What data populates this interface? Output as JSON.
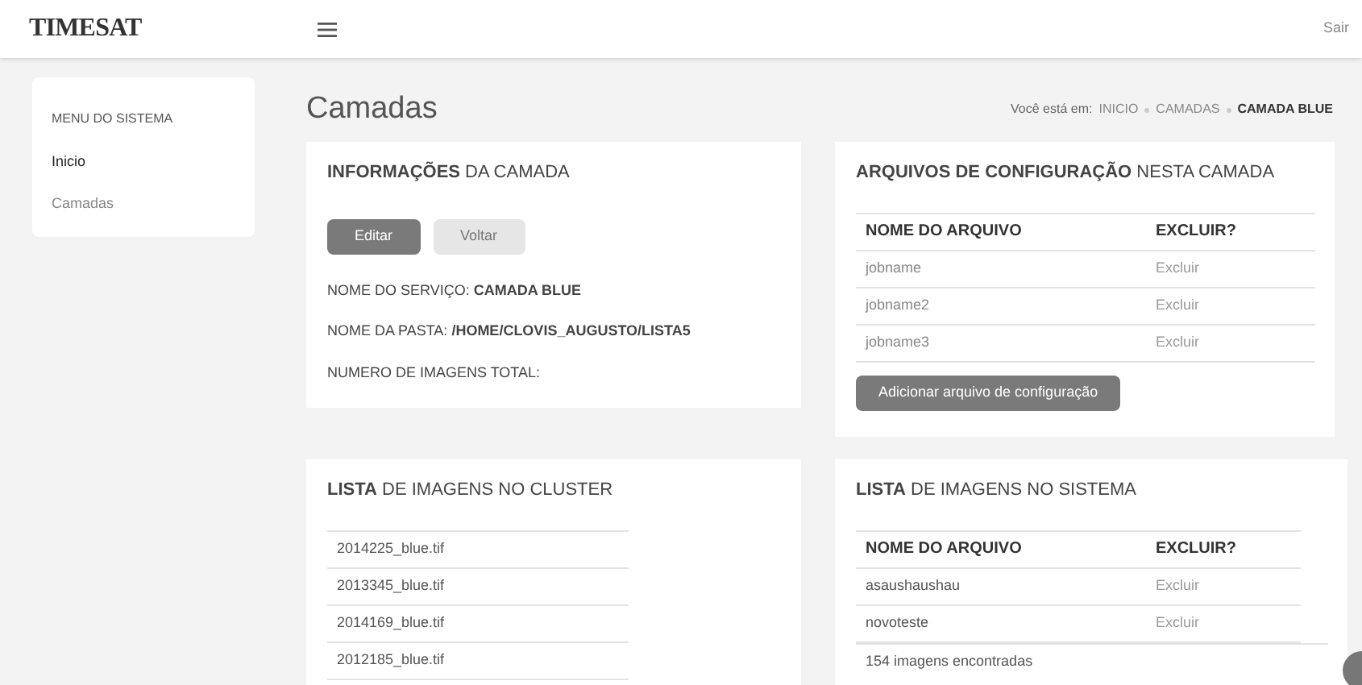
{
  "header": {
    "logo": "TIMESAT",
    "logout": "Sair"
  },
  "sidebar": {
    "title": "MENU DO SISTEMA",
    "items": [
      {
        "label": "Inicio",
        "selected": true
      },
      {
        "label": "Camadas",
        "selected": false
      }
    ]
  },
  "page_title": "Camadas",
  "breadcrumb": {
    "prefix": "Você está em:",
    "items": [
      {
        "label": "INICIO",
        "current": false
      },
      {
        "label": "CAMADAS",
        "current": false
      },
      {
        "label": "CAMADA BLUE",
        "current": true
      }
    ]
  },
  "info_card": {
    "title": "**INFORMAÇÕES** DA CAMADA",
    "buttons": [
      {
        "label": "Editar",
        "kind": "primary"
      },
      {
        "label": "Voltar",
        "kind": "secondary"
      }
    ],
    "fields": [
      "NOME DO SERVIÇO: **CAMADA BLUE**",
      "NOME DA PASTA: **/HOME/CLOVIS_AUGUSTO/LISTA5**",
      "NUMERO DE IMAGENS TOTAL:"
    ]
  },
  "config_card": {
    "title": "**ARQUIVOS DE CONFIGURAÇÃO** NESTA CAMADA",
    "columns": [
      "NOME DO ARQUIVO",
      "EXCLUIR?"
    ],
    "rows": [
      [
        "jobname",
        "Excluir"
      ],
      [
        "jobname2",
        "Excluir"
      ],
      [
        "jobname3",
        "Excluir"
      ]
    ],
    "button": "Adicionar arquivo de configuração"
  },
  "cluster_card": {
    "title": "**LISTA** DE IMAGENS NO CLUSTER",
    "items": [
      "2014225_blue.tif",
      "2013345_blue.tif",
      "2014169_blue.tif",
      "2012185_blue.tif"
    ]
  },
  "system_card": {
    "title": "**LISTA** DE IMAGENS NO SISTEMA",
    "columns": [
      "NOME DO ARQUIVO",
      "EXCLUIR?"
    ],
    "rows": [
      [
        "asaushaushau",
        "Excluir"
      ],
      [
        "novoteste",
        "Excluir"
      ]
    ],
    "footer": "154 imagens encontradas"
  }
}
